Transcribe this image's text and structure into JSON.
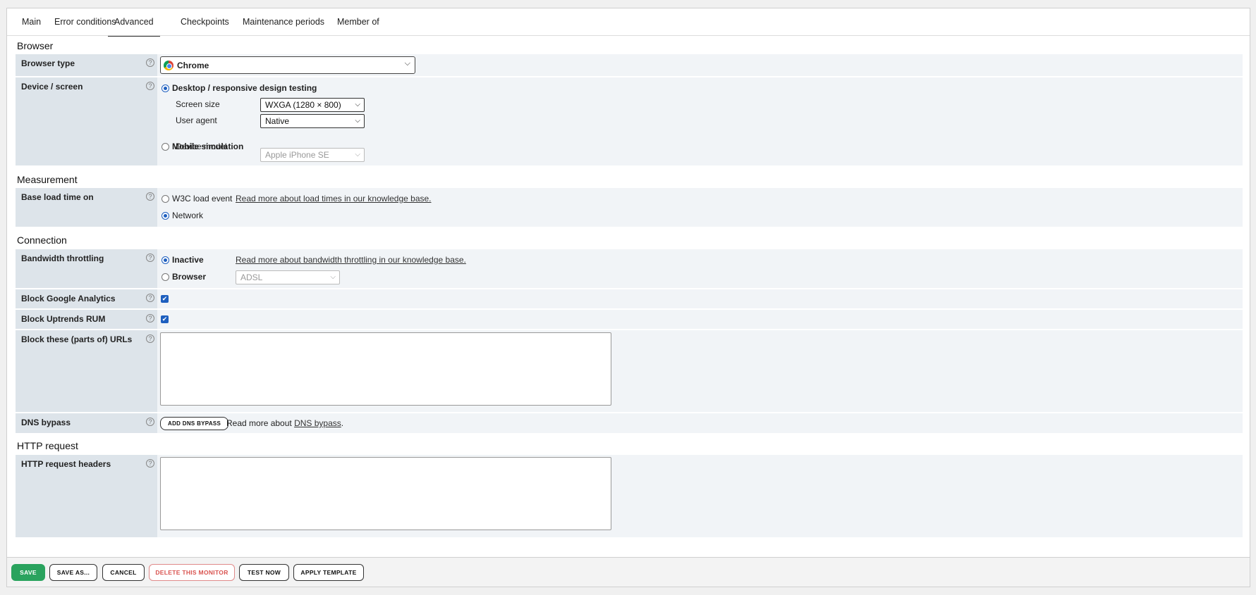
{
  "tabs": [
    "Main",
    "Error conditions",
    "Advanced",
    "Checkpoints",
    "Maintenance periods",
    "Member of"
  ],
  "help_glyph": "?",
  "sections": {
    "browser": "Browser",
    "measurement": "Measurement",
    "connection": "Connection",
    "http": "HTTP request"
  },
  "browser_type": {
    "label": "Browser type",
    "value": "Chrome",
    "chevron": "⌵"
  },
  "device": {
    "label": "Device / screen",
    "desktop_option": "Desktop / responsive design testing",
    "screen_size_label": "Screen size",
    "screen_size_value": "WXGA (1280 × 800)",
    "user_agent_label": "User agent",
    "user_agent_value": "Native",
    "mobile_option": "Mobile simulation",
    "device_model_label": "Device model",
    "device_model_value": "Apple iPhone SE"
  },
  "load_time": {
    "label": "Base load time on",
    "w3c_option": "W3C load event",
    "network_option": "Network",
    "link": "Read more about load times in our knowledge base."
  },
  "bandwidth": {
    "label": "Bandwidth throttling",
    "inactive_option": "Inactive",
    "browser_option": "Browser",
    "browser_value": "ADSL",
    "link": "Read more about bandwidth throttling in our knowledge base."
  },
  "block_ga": {
    "label": "Block Google Analytics",
    "check": "✔"
  },
  "block_rum": {
    "label": "Block Uptrends RUM",
    "check": "✔"
  },
  "block_urls": {
    "label": "Block these (parts of) URLs"
  },
  "dns": {
    "label": "DNS bypass",
    "button": "ADD DNS BYPASS",
    "text": "Read more about",
    "link": "DNS bypass",
    "period": "."
  },
  "http_headers": {
    "label": "HTTP request headers"
  },
  "footer": {
    "save": "SAVE",
    "save_as": "SAVE AS...",
    "cancel": "CANCEL",
    "delete": "DELETE THIS MONITOR",
    "test": "TEST NOW",
    "apply": "APPLY TEMPLATE"
  },
  "colors": {
    "label_bg": "#dde4ea",
    "content_bg": "#f1f4f7",
    "primary": "#2aa35e",
    "danger": "#d9534f",
    "radio": "#1e5fbf"
  }
}
